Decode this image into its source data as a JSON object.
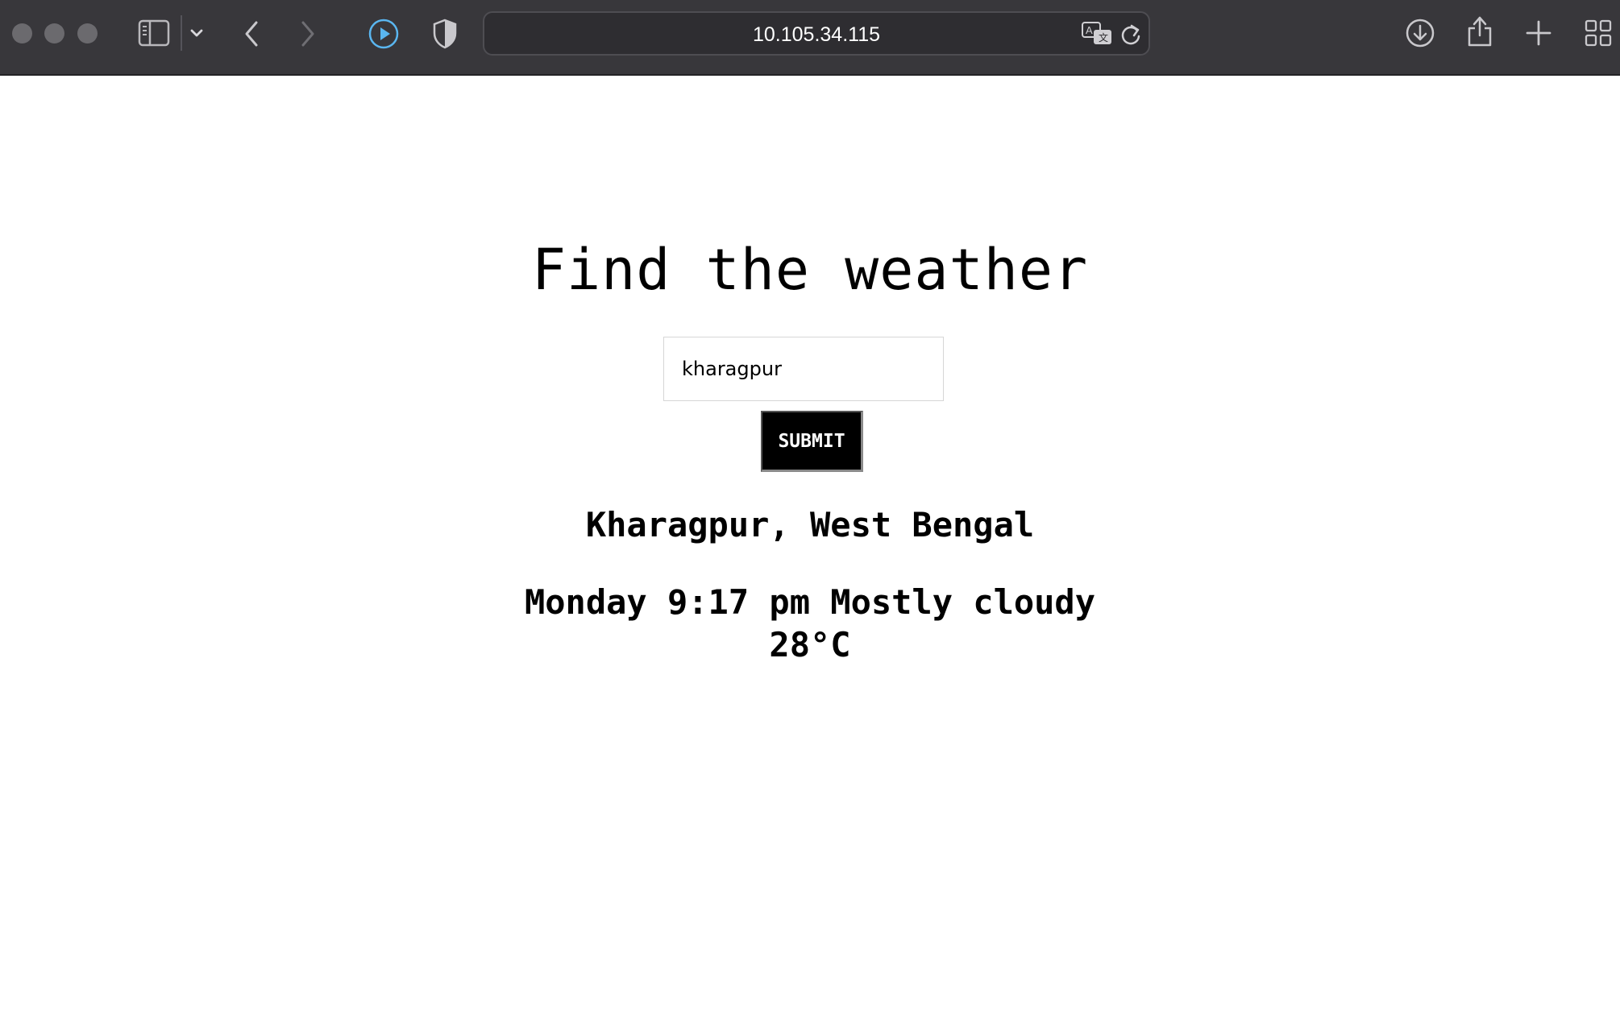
{
  "browser": {
    "url": "10.105.34.115",
    "icons": {
      "sidebar": "sidebar-icon",
      "sidebar_menu": "chevron-down-icon",
      "back": "chevron-left-icon",
      "forward": "chevron-right-icon",
      "media": "play-circle-icon",
      "privacy": "shield-icon",
      "translate": "translate-icon",
      "reload": "reload-icon",
      "downloads": "download-icon",
      "share": "share-icon",
      "new_tab": "plus-icon",
      "tab_overview": "grid-icon"
    }
  },
  "page": {
    "title": "Find the weather",
    "search": {
      "value": "kharagpur"
    },
    "submit_label": "SUBMIT",
    "result": {
      "location": "Kharagpur, West Bengal",
      "summary_line": "Monday 9:17 pm Mostly cloudy",
      "temperature": "28°C"
    }
  }
}
